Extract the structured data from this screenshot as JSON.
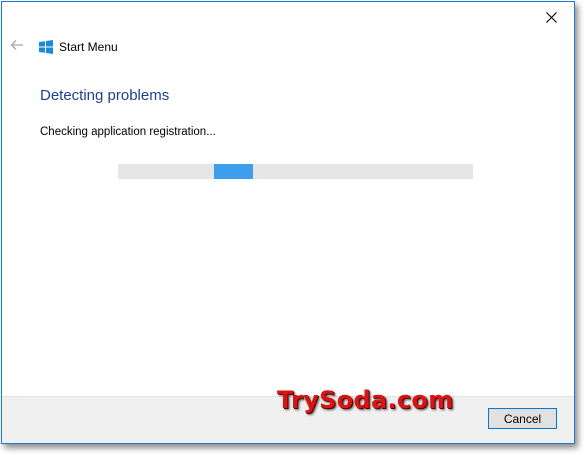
{
  "window": {
    "app_title": "Start Menu",
    "heading": "Detecting problems",
    "status": "Checking application registration...",
    "progress": {
      "mode": "indeterminate",
      "chunk_position_fraction": 0.27,
      "color": "#3c9eec"
    }
  },
  "footer": {
    "cancel_label": "Cancel"
  },
  "icons": {
    "close": "close-icon",
    "back": "back-arrow-icon",
    "app": "windows-logo-icon"
  },
  "colors": {
    "accent_border": "#1e78d7",
    "heading": "#1f3f8f",
    "watermark": "#d81515"
  },
  "watermark": {
    "text": "TrySoda.com"
  }
}
